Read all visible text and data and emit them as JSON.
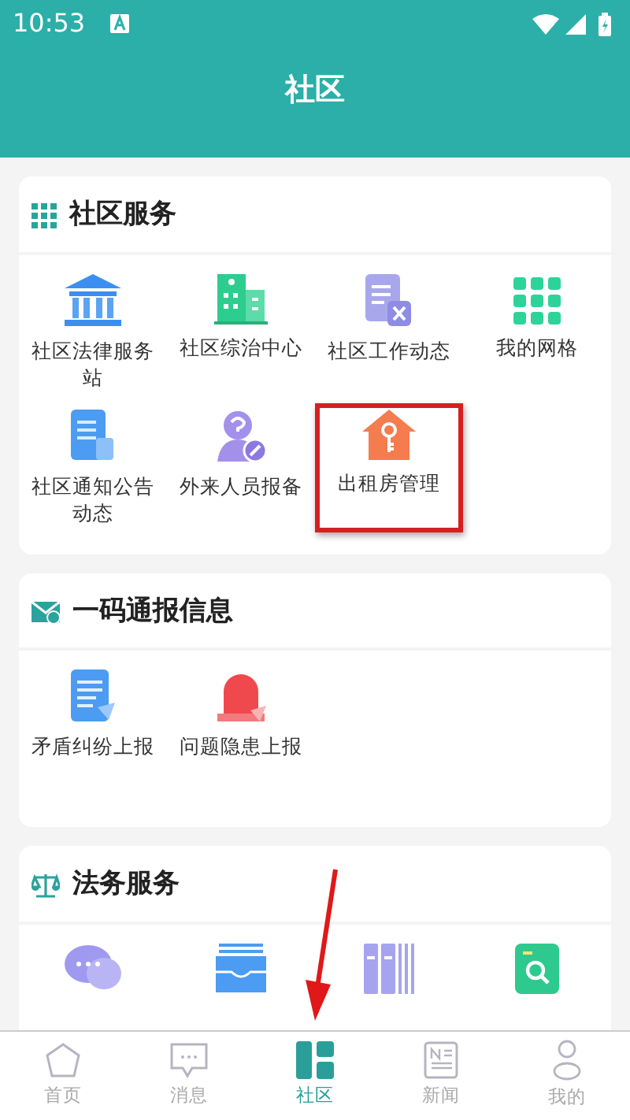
{
  "status_bar": {
    "time": "10:53"
  },
  "title": "社区",
  "sections": [
    {
      "title": "社区服务",
      "items": [
        {
          "kind": "tile",
          "label": "社区法律服务站",
          "highlighted": false
        },
        {
          "kind": "tile",
          "label": "社区综治中心",
          "highlighted": false
        },
        {
          "kind": "tile",
          "label": "社区工作动态",
          "highlighted": false
        },
        {
          "kind": "tile",
          "label": "我的网格",
          "highlighted": false
        },
        {
          "kind": "tile",
          "label": "社区通知公告动态",
          "highlighted": false
        },
        {
          "kind": "tile",
          "label": "外来人员报备",
          "highlighted": false
        },
        {
          "kind": "tile",
          "label": "出租房管理",
          "highlighted": true
        }
      ]
    },
    {
      "title": "一码通报信息",
      "items": [
        {
          "kind": "tile",
          "label": "矛盾纠纷上报",
          "highlighted": false
        },
        {
          "kind": "tile",
          "label": "问题隐患上报",
          "highlighted": false
        }
      ]
    },
    {
      "title": "法务服务",
      "items": [
        {
          "kind": "icon"
        },
        {
          "kind": "icon"
        },
        {
          "kind": "icon"
        },
        {
          "kind": "icon"
        }
      ]
    }
  ],
  "annotation_arrow": true,
  "bottom_nav": [
    {
      "label": "首页",
      "selected": false
    },
    {
      "label": "消息",
      "selected": false
    },
    {
      "label": "社区",
      "selected": true
    },
    {
      "label": "新闻",
      "selected": false
    },
    {
      "label": "我的",
      "selected": false
    }
  ]
}
